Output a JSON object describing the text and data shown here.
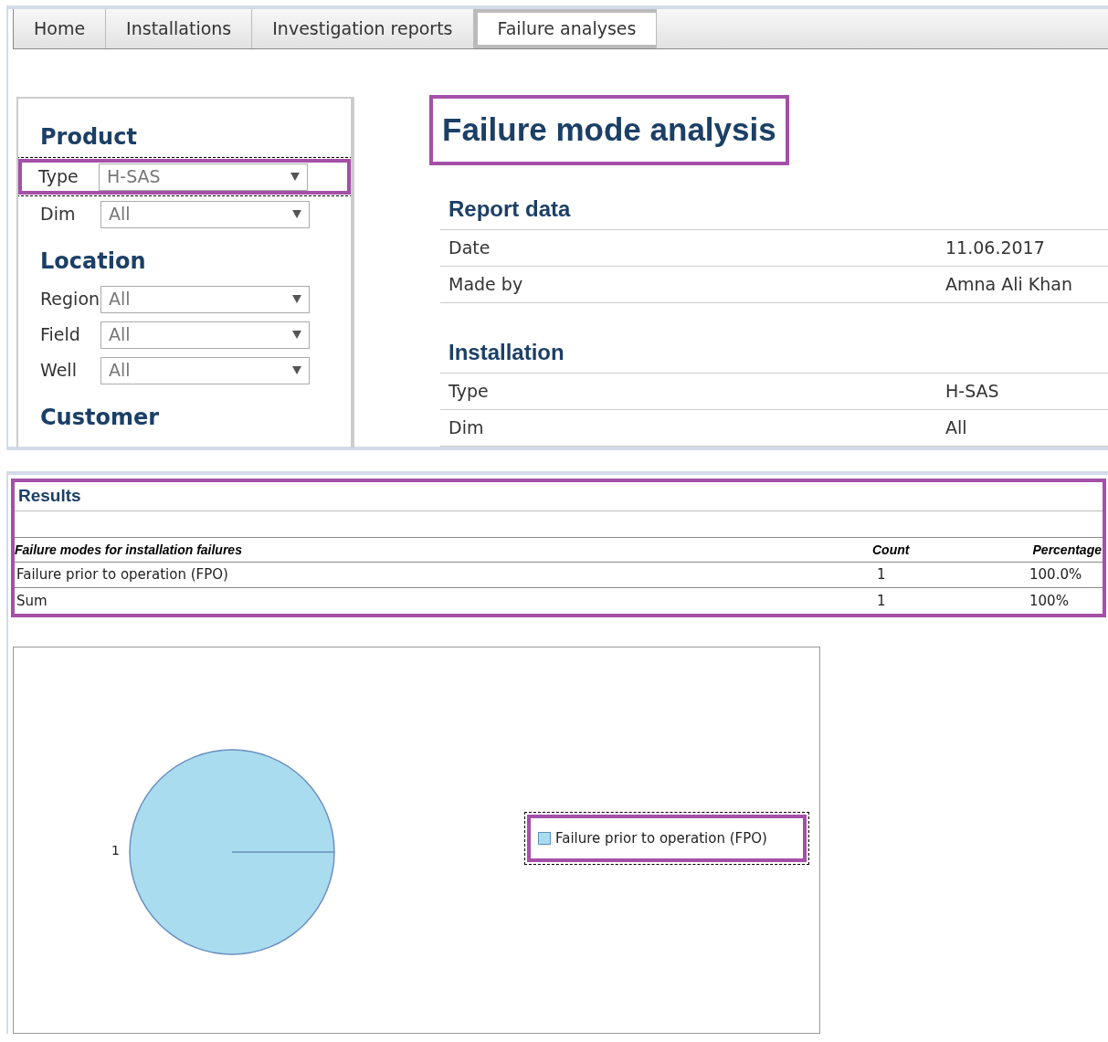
{
  "tabs": [
    {
      "label": "Home",
      "selected": false,
      "highlighted": false
    },
    {
      "label": "Installations",
      "selected": false,
      "highlighted": false
    },
    {
      "label": "Investigation reports",
      "selected": false,
      "highlighted": false
    },
    {
      "label": "Failure analyses",
      "selected": true,
      "highlighted": true
    }
  ],
  "filters": [
    {
      "heading": "Product",
      "fields": [
        {
          "label": "Type",
          "value": "H-SAS",
          "highlighted": true
        },
        {
          "label": "Dim",
          "value": "All",
          "highlighted": false
        }
      ]
    },
    {
      "heading": "Location",
      "fields": [
        {
          "label": "Region",
          "value": "All",
          "highlighted": false
        },
        {
          "label": "Field",
          "value": "All",
          "highlighted": false
        },
        {
          "label": "Well",
          "value": "All",
          "highlighted": false
        }
      ]
    },
    {
      "heading": "Customer"
    }
  ],
  "page_title": {
    "text": "Failure mode analysis",
    "highlighted": true
  },
  "info_sections": [
    {
      "heading": "Report data",
      "rows": [
        {
          "label": "Date",
          "value": "11.06.2017"
        },
        {
          "label": "Made by",
          "value": "Amna Ali Khan"
        }
      ]
    },
    {
      "heading": "Installation",
      "rows": [
        {
          "label": "Type",
          "value": "H-SAS"
        },
        {
          "label": "Dim",
          "value": "All"
        }
      ]
    }
  ],
  "results": {
    "title": "Results",
    "highlighted": true,
    "columns": [
      "Failure modes for installation failures",
      "Count",
      "Percentage"
    ],
    "rows": [
      {
        "mode": "Failure prior to operation (FPO)",
        "count": "1",
        "percentage": "100.0%"
      },
      {
        "mode": "Sum",
        "count": "1",
        "percentage": "100%"
      }
    ]
  },
  "chart": {
    "legend_highlighted": true,
    "chart_data": {
      "type": "pie",
      "categories": [
        "Failure prior to operation (FPO)"
      ],
      "series": [
        {
          "color": "#a9dcef",
          "values": [
            1
          ]
        }
      ],
      "data_labels": true
    }
  }
}
